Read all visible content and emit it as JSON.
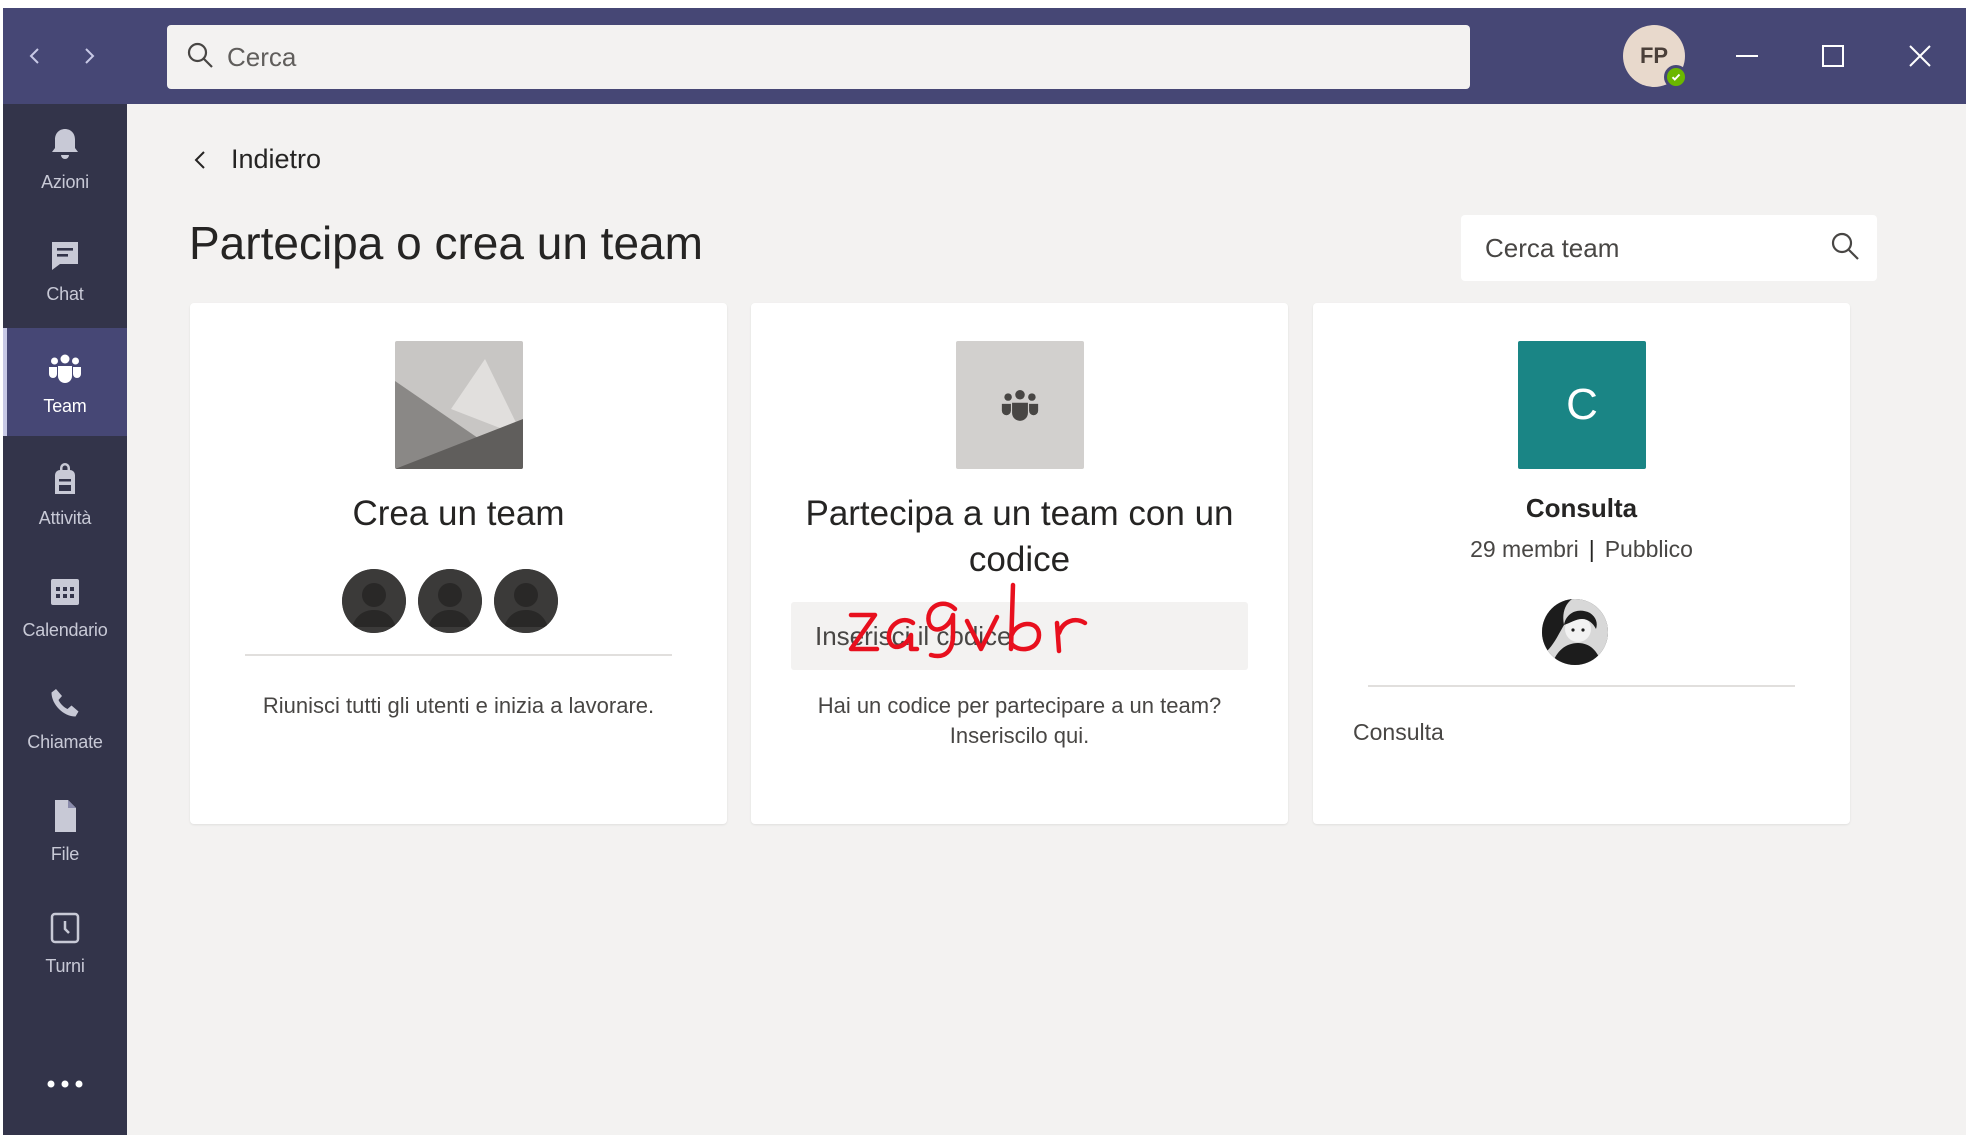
{
  "titlebar": {
    "search_placeholder": "Cerca",
    "user_initials": "FP",
    "status_color": "#6bb700"
  },
  "rail": {
    "items": [
      {
        "label": "Azioni",
        "icon": "bell-icon"
      },
      {
        "label": "Chat",
        "icon": "chat-icon"
      },
      {
        "label": "Team",
        "icon": "teams-icon",
        "active": true
      },
      {
        "label": "Attività",
        "icon": "backpack-icon"
      },
      {
        "label": "Calendario",
        "icon": "calendar-icon"
      },
      {
        "label": "Chiamate",
        "icon": "phone-icon"
      },
      {
        "label": "File",
        "icon": "file-icon"
      },
      {
        "label": "Turni",
        "icon": "clock-icon"
      }
    ],
    "more_icon": "more-icon"
  },
  "main": {
    "back_label": "Indietro",
    "page_title": "Partecipa o crea un team",
    "team_search_placeholder": "Cerca team"
  },
  "cards": {
    "create": {
      "title": "Crea un team",
      "description": "Riunisci tutti gli utenti e inizia a lavorare."
    },
    "join_code": {
      "title": "Partecipa a un team con un codice",
      "input_placeholder": "Inserisci il codice",
      "handwritten_code": "za9vbr",
      "description": "Hai un codice per partecipare a un team? Inseriscilo qui."
    },
    "consulta": {
      "letter": "C",
      "name": "Consulta",
      "members": "29 membri",
      "separator": "|",
      "visibility": "Pubblico",
      "description": "Consulta",
      "tile_color": "#1a8585"
    }
  },
  "colors": {
    "titlebar": "#464775",
    "rail": "#33344a",
    "background": "#f3f2f1"
  }
}
